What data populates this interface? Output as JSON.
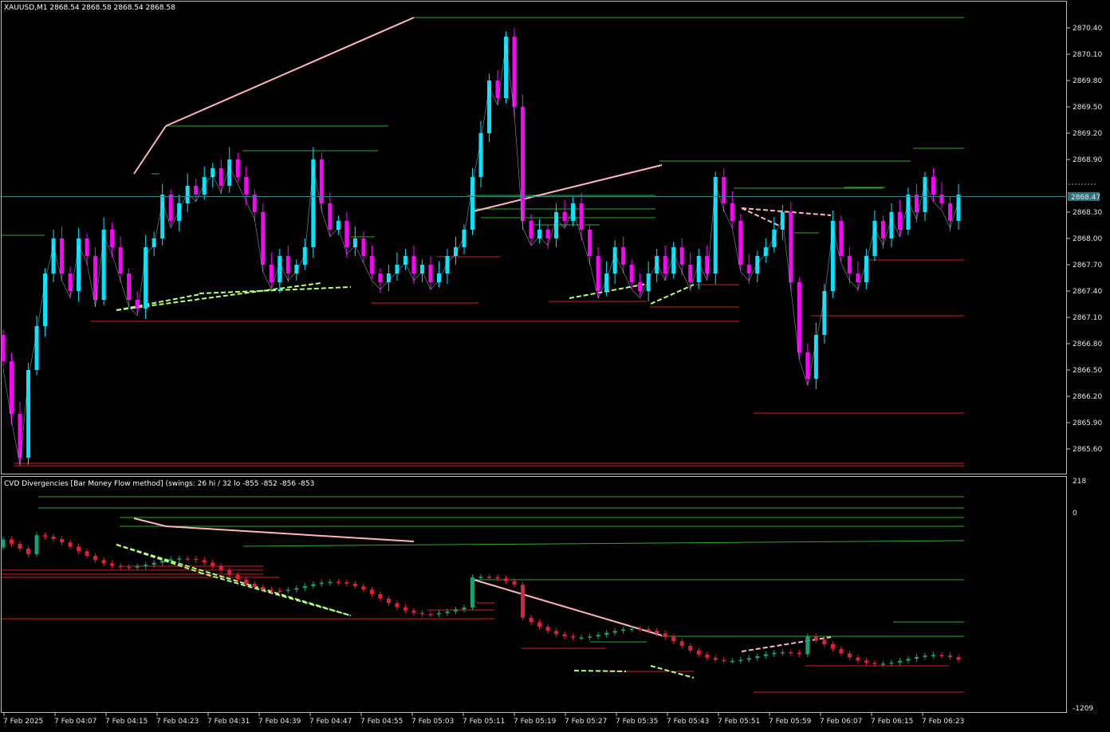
{
  "main_chart": {
    "title": "XAUUSD,M1  2868.54 2868.58 2868.54 2868.58",
    "symbol": "XAUUSD",
    "timeframe": "M1",
    "ohlc": {
      "open": 2868.54,
      "high": 2868.58,
      "low": 2868.54,
      "close": 2868.58
    },
    "price_labels": [
      "2870.40",
      "2870.10",
      "2869.80",
      "2869.50",
      "2869.20",
      "2868.90",
      "2868.30",
      "2868.00",
      "2867.70",
      "2867.40",
      "2867.10",
      "2866.80",
      "2866.50",
      "2866.20",
      "2865.90",
      "2865.60"
    ],
    "current_price": "2868.47"
  },
  "indicator": {
    "title": "CVD Divergencies [Bar Money Flow method] (swings: 26 hi / 32 lo -855 -852 -856 -853",
    "scale_labels": [
      "218",
      "0",
      "-1209"
    ]
  },
  "time_axis": [
    "7 Feb 2025",
    "7 Feb 04:07",
    "7 Feb 04:15",
    "7 Feb 04:23",
    "7 Feb 04:31",
    "7 Feb 04:39",
    "7 Feb 04:47",
    "7 Feb 04:55",
    "7 Feb 05:03",
    "7 Feb 05:11",
    "7 Feb 05:19",
    "7 Feb 05:27",
    "7 Feb 05:35",
    "7 Feb 05:43",
    "7 Feb 05:51",
    "7 Feb 05:59",
    "7 Feb 06:07",
    "7 Feb 06:15",
    "7 Feb 06:23"
  ],
  "colors": {
    "background": "#000000",
    "bull_candle": "#00e5ff",
    "bear_candle": "#ff00ff",
    "cvd_bull": "#1a9e78",
    "cvd_bear": "#e0203a",
    "swing_high": "#2fa82f",
    "swing_low": "#d42020",
    "bearish_divergence": "#ffb6c1",
    "bullish_divergence": "#b4ff80",
    "price_line": "#3a7f8a"
  },
  "chart_data": {
    "type": "candlestick",
    "main_ylim": [
      2865.35,
      2870.55
    ],
    "cvd_ylim": [
      -1209,
      218
    ],
    "price_closes": [
      2866.6,
      2866.0,
      2865.5,
      2866.5,
      2867.0,
      2867.6,
      2868.0,
      2867.6,
      2867.4,
      2868.0,
      2867.8,
      2867.3,
      2868.1,
      2867.9,
      2867.6,
      2867.3,
      2867.2,
      2867.9,
      2868.0,
      2868.5,
      2868.2,
      2868.4,
      2868.6,
      2868.5,
      2868.7,
      2868.8,
      2868.6,
      2868.9,
      2868.7,
      2868.5,
      2868.3,
      2867.7,
      2867.5,
      2867.8,
      2867.6,
      2867.7,
      2867.9,
      2868.9,
      2868.4,
      2868.1,
      2868.2,
      2867.9,
      2868.0,
      2867.8,
      2867.6,
      2867.5,
      2867.6,
      2867.7,
      2867.8,
      2867.6,
      2867.7,
      2867.5,
      2867.6,
      2867.8,
      2867.9,
      2868.1,
      2868.7,
      2869.2,
      2869.8,
      2869.6,
      2870.3,
      2869.5,
      2868.2,
      2868.0,
      2868.1,
      2868.0,
      2868.3,
      2868.2,
      2868.4,
      2868.1,
      2867.8,
      2867.4,
      2867.6,
      2867.9,
      2867.7,
      2867.5,
      2867.4,
      2867.6,
      2867.8,
      2867.6,
      2867.9,
      2867.7,
      2867.5,
      2867.8,
      2867.6,
      2868.7,
      2868.4,
      2868.2,
      2867.7,
      2867.6,
      2867.8,
      2867.9,
      2868.1,
      2868.3,
      2867.5,
      2866.7,
      2866.4,
      2866.9,
      2867.4,
      2868.2,
      2867.8,
      2867.6,
      2867.5,
      2867.8,
      2868.2,
      2868.0,
      2868.3,
      2868.1,
      2868.5,
      2868.3,
      2868.7,
      2868.5,
      2868.4,
      2868.2,
      2868.5
    ]
  }
}
